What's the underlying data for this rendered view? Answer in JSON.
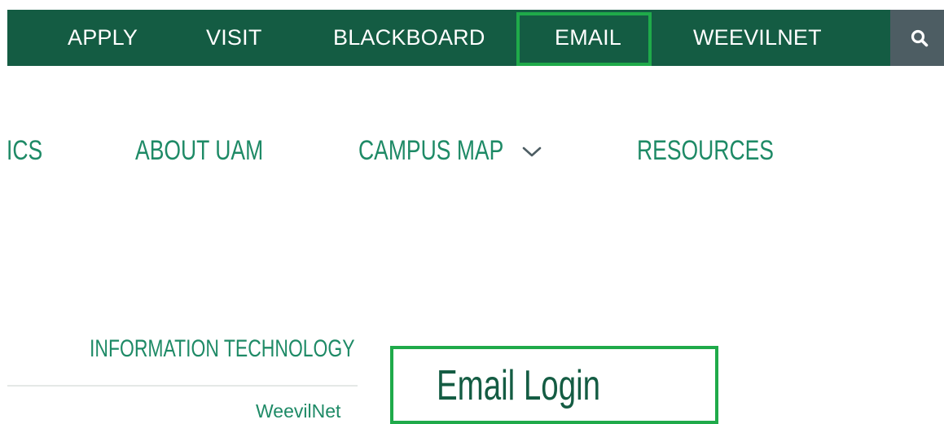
{
  "top_nav": {
    "links": [
      {
        "label": "APPLY"
      },
      {
        "label": "VISIT"
      },
      {
        "label": "BLACKBOARD"
      },
      {
        "label": "EMAIL"
      },
      {
        "label": "WEEVILNET"
      }
    ],
    "search_icon": "search-icon",
    "colors": {
      "bar": "#145c43",
      "search_bg": "#4d5d63",
      "highlight": "#1faa4a"
    }
  },
  "main_nav": {
    "items": [
      {
        "label": "ICS"
      },
      {
        "label": "ABOUT UAM"
      },
      {
        "label": "CAMPUS MAP"
      },
      {
        "label": "RESOURCES"
      }
    ],
    "dropdown_icon": "chevron-down-icon",
    "color": "#1e8a66"
  },
  "sidebar": {
    "heading": "INFORMATION TECHNOLOGY",
    "links": [
      {
        "label": "WeevilNet"
      }
    ]
  },
  "page": {
    "title": "Email Login"
  }
}
